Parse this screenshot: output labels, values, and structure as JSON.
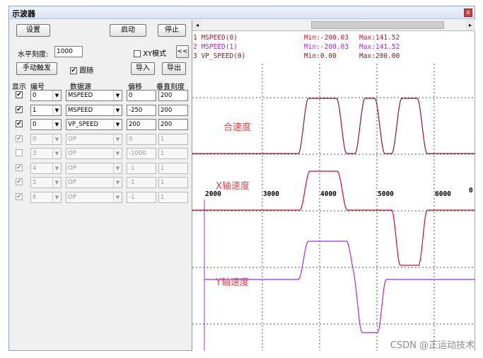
{
  "window": {
    "title": "示波器",
    "close_glyph": "x"
  },
  "controls": {
    "setup_label": "设置",
    "start_label": "启动",
    "stop_label": "停止",
    "hscale_label": "水平刻度:",
    "hscale_value": "1000",
    "xy_mode_label": "XY模式",
    "xy_mode_checked": false,
    "collapse_label": "<<",
    "manual_trigger_label": "手动触发",
    "follow_label": "跟随",
    "follow_checked": true,
    "import_label": "导入",
    "export_label": "导出"
  },
  "table": {
    "headers": {
      "show": "显示",
      "index": "编号",
      "source": "数据源",
      "offset": "偏移",
      "vscale": "垂直刻度"
    },
    "rows": [
      {
        "show": true,
        "enabled": true,
        "index": "0",
        "source": "MSPEED",
        "offset": "0",
        "vscale": "200"
      },
      {
        "show": true,
        "enabled": true,
        "index": "1",
        "source": "MSPEED",
        "offset": "-250",
        "vscale": "200"
      },
      {
        "show": true,
        "enabled": true,
        "index": "0",
        "source": "VP_SPEED",
        "offset": "200",
        "vscale": "200"
      },
      {
        "show": true,
        "enabled": false,
        "index": "0",
        "source": "OP",
        "offset": "0",
        "vscale": "1"
      },
      {
        "show": false,
        "enabled": false,
        "index": "3",
        "source": "OP",
        "offset": "-1000",
        "vscale": "1"
      },
      {
        "show": true,
        "enabled": false,
        "index": "4",
        "source": "OP",
        "offset": "-1",
        "vscale": "1"
      },
      {
        "show": true,
        "enabled": false,
        "index": "5",
        "source": "OP",
        "offset": "-1",
        "vscale": "1"
      },
      {
        "show": true,
        "enabled": false,
        "index": "6",
        "source": "OP",
        "offset": "-1",
        "vscale": "1"
      }
    ]
  },
  "scope": {
    "scroll_left_glyph": "◂",
    "scroll_right_glyph": "▸",
    "legend": [
      {
        "name": "1 MSPEED(0)",
        "min": "Min:-200.03",
        "max": "Max:141.52",
        "color": "#c8102e"
      },
      {
        "name": "2 MSPEED(1)",
        "min": "Min:-200.03",
        "max": "Max:141.52",
        "color": "#9a2ff0"
      },
      {
        "name": "3 VP_SPEED(0)",
        "min": "Min:0.00",
        "max": "Max:200.00",
        "color": "#7a1e1e"
      }
    ],
    "x_ticks": [
      "2000",
      "3000",
      "4000",
      "5000",
      "6000"
    ],
    "edge_zero": "0",
    "labels": {
      "combined": "合速度",
      "x_axis": "X轴速度",
      "y_axis": "Y轴速度"
    },
    "colors": {
      "combined": "#8b1a2b",
      "x_axis": "#c8102e",
      "y_axis": "#9a2ff0"
    }
  },
  "watermark": "CSDN @正运动技术"
}
